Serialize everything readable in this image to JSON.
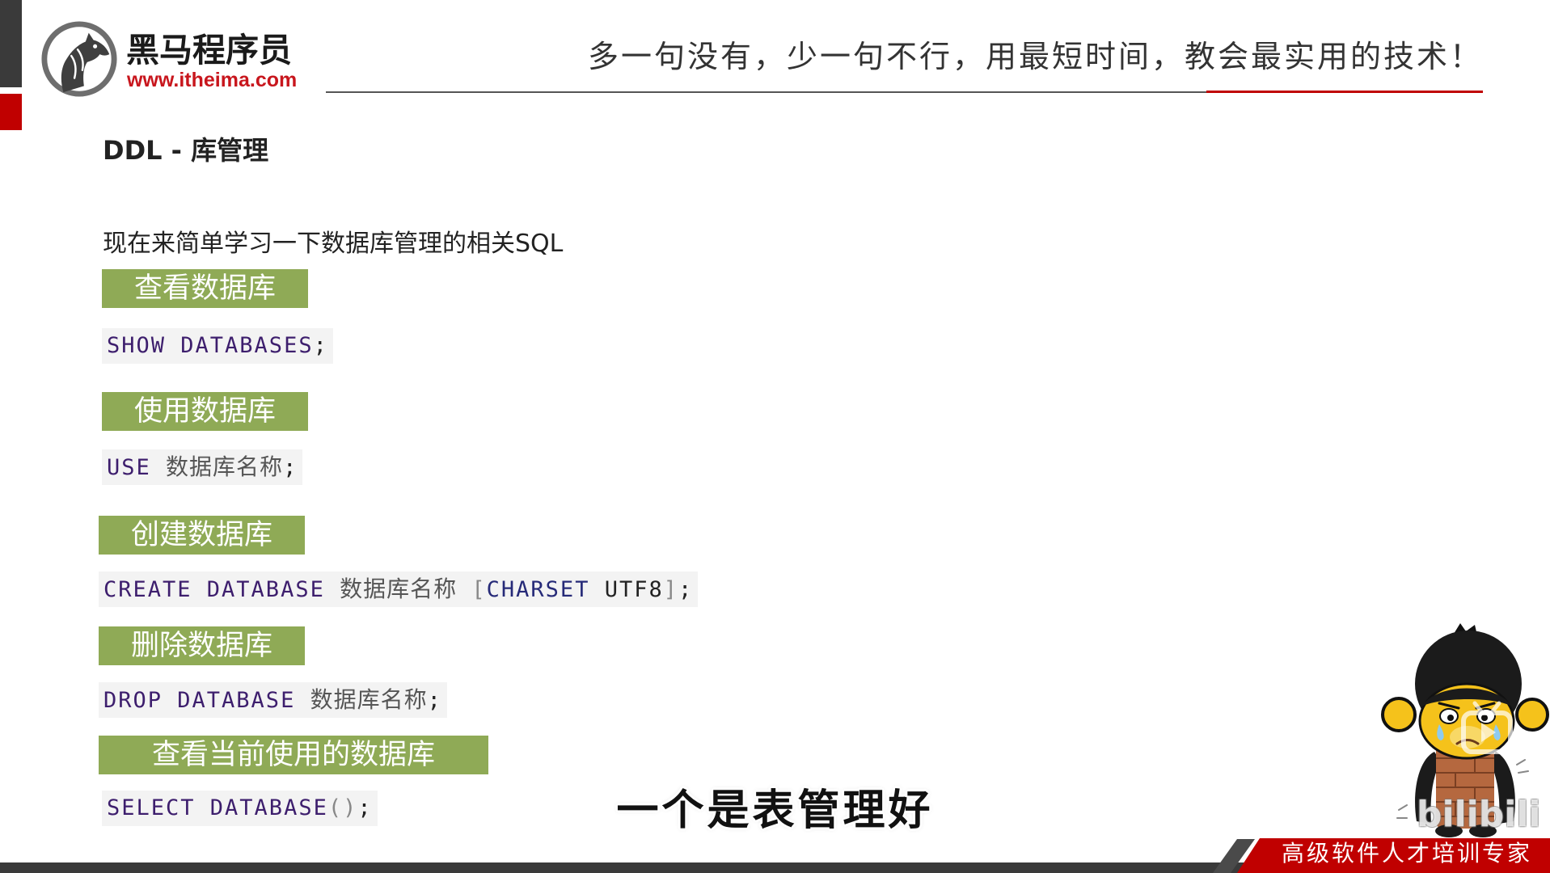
{
  "brand": {
    "name": "黑马程序员",
    "url": "www.itheima.com",
    "logo_icon": "horse-head-logo"
  },
  "header": {
    "slogan": "多一句没有，少一句不行，用最短时间，教会最实用的技术！"
  },
  "slide": {
    "title": "DDL - 库管理",
    "intro": "现在来简单学习一下数据库管理的相关SQL",
    "sections": [
      {
        "label": "查看数据库",
        "code": [
          "SHOW DATABASES",
          ";"
        ]
      },
      {
        "label": "使用数据库",
        "code": [
          "USE",
          "数据库名称",
          ";"
        ]
      },
      {
        "label": "创建数据库",
        "code": [
          "CREATE DATABASE",
          "数据库名称",
          "[",
          "CHARSET",
          "UTF8",
          "]",
          ";"
        ]
      },
      {
        "label": "删除数据库",
        "code": [
          "DROP DATABASE",
          "数据库名称",
          ";"
        ]
      },
      {
        "label": "查看当前使用的数据库",
        "code": [
          "SELECT DATABASE",
          "()",
          ";"
        ]
      }
    ]
  },
  "subtitle": "一个是表管理好",
  "footer": {
    "tagline": "高级软件人才培训专家"
  },
  "mascot": {
    "icon": "crying-monkey-mascot"
  },
  "watermark": {
    "text": "bilibili",
    "icon": "bilibili-tv-icon"
  },
  "colors": {
    "accent_red": "#c00000",
    "brand_url_red": "#c8161d",
    "label_green": "#8faa56",
    "code_background": "#f3f3f3",
    "keyword_purple": "#3d1e6d",
    "option_navy": "#262a78",
    "placeholder_gray": "#555555",
    "bracket_gray": "#888888",
    "dark_bar": "#3a3a3a"
  }
}
